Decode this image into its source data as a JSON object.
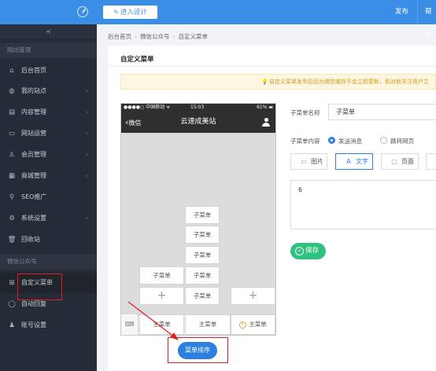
{
  "topbar": {
    "design_label": "进入设计",
    "publish_label": "发布",
    "help_label": "帮助"
  },
  "sidebar": {
    "group1_title": "网站管理",
    "group2_title": "微信公众号",
    "items": [
      {
        "label": "后台首页",
        "icon": "home-icon"
      },
      {
        "label": "我的站点",
        "icon": "globe-icon"
      },
      {
        "label": "内容管理",
        "icon": "document-icon"
      },
      {
        "label": "网站运营",
        "icon": "monitor-icon"
      },
      {
        "label": "会员管理",
        "icon": "users-icon"
      },
      {
        "label": "商城管理",
        "icon": "store-icon"
      },
      {
        "label": "SEO推广",
        "icon": "search-icon"
      },
      {
        "label": "系统设置",
        "icon": "gear-icon"
      },
      {
        "label": "回收站",
        "icon": "trash-icon"
      },
      {
        "label": "自定义菜单",
        "icon": "grid-icon"
      },
      {
        "label": "自动回复",
        "icon": "chat-icon"
      },
      {
        "label": "账号设置",
        "icon": "user-icon"
      }
    ]
  },
  "breadcrumb": [
    "后台首页",
    "微信公众号",
    "自定义菜单"
  ],
  "panel": {
    "title": "自定义菜单",
    "notice": "自定义菜单发布后因为微信缓存不会立即更新，假对新关注用户立"
  },
  "phone": {
    "status_left": "●●●●○ 中国移动 ᯤ",
    "status_time": "15:03",
    "status_right": "61% ▬",
    "back_label": "微信",
    "nav_title": "云速成美站",
    "sub_label": "子菜单",
    "main_label": "主菜单",
    "plus": "+",
    "sort_label": "菜单排序"
  },
  "editor": {
    "name_label": "子菜单名称",
    "name_value": "子菜单",
    "content_label": "子菜单内容",
    "radio_send": "发送消息",
    "radio_jump": "跳转网页",
    "tab_image": "图片",
    "tab_text": "文字",
    "tab_page": "页面",
    "textarea_value": "6",
    "save_label": "保存"
  }
}
